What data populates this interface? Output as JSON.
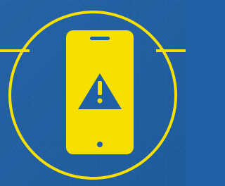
{
  "colors": {
    "background": "#1f5fa3",
    "accent": "#f7df00",
    "screen": "#f7df00",
    "symbol": "#1f5fa3"
  },
  "icons": {
    "main": "mobile-phone-warning-icon",
    "warning": "warning-triangle-icon"
  }
}
